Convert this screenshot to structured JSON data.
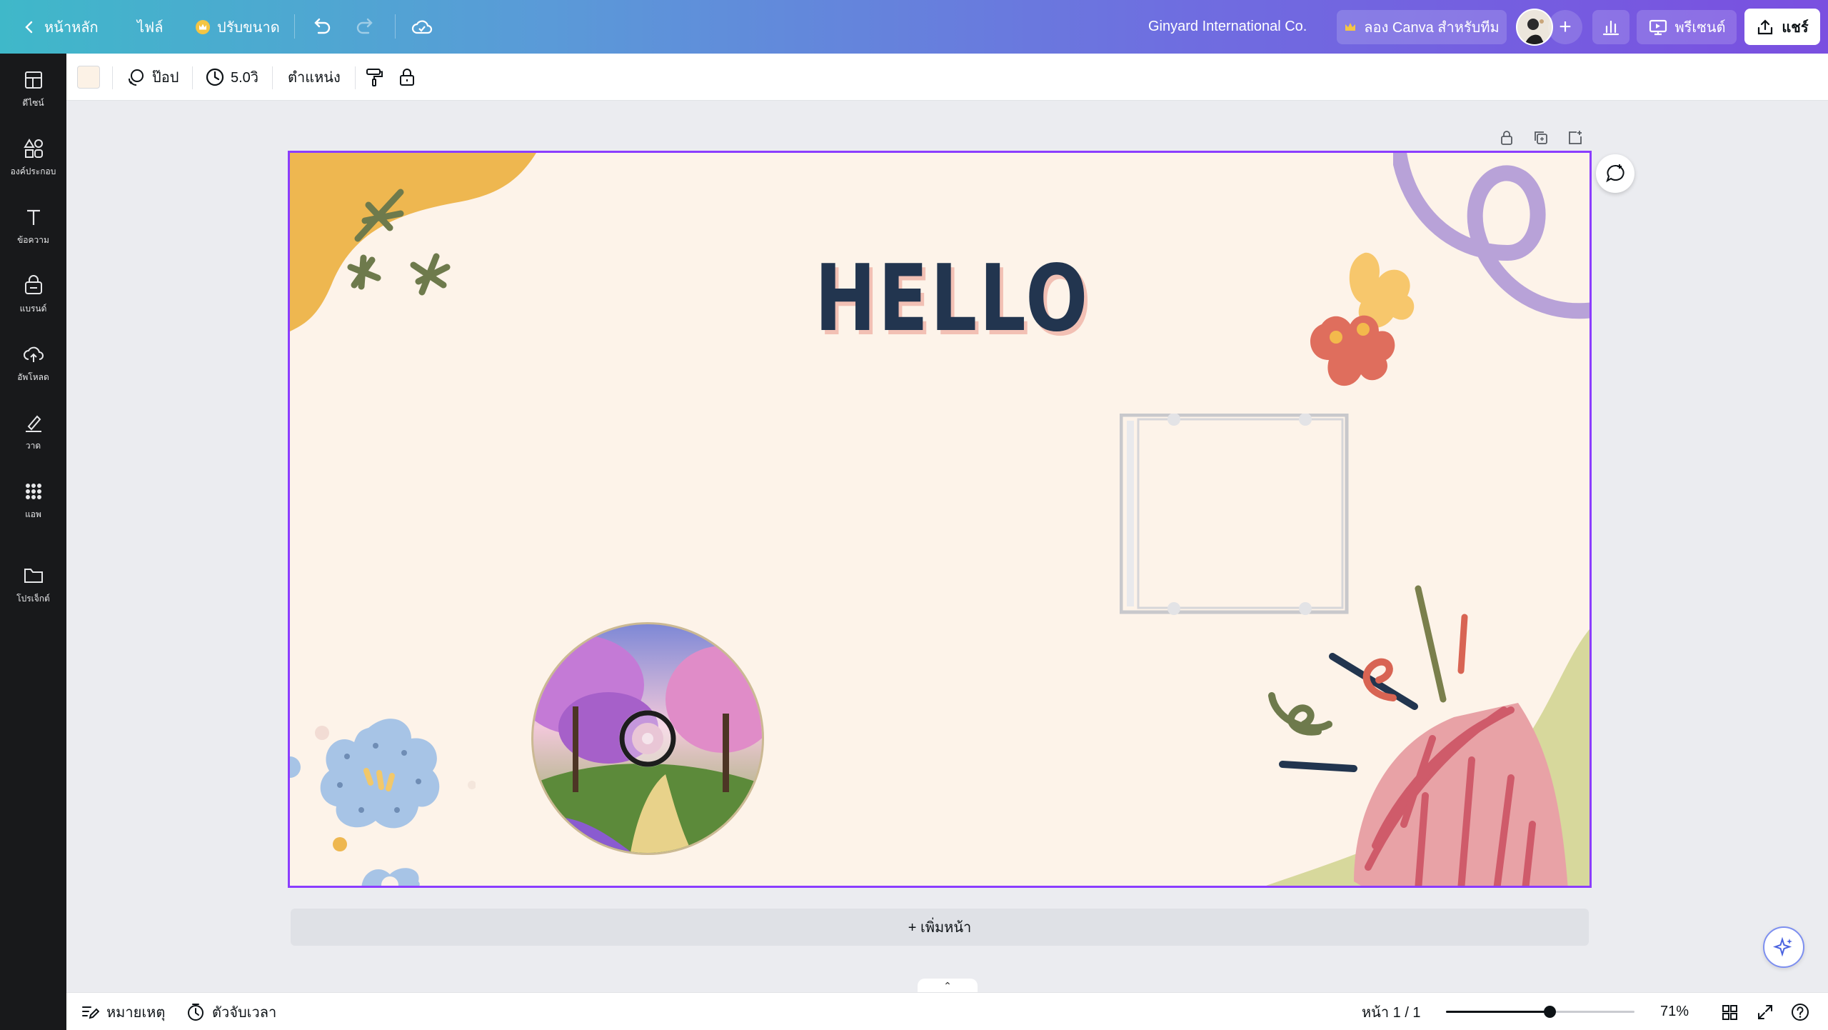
{
  "topbar": {
    "home_label": "หน้าหลัก",
    "file_label": "ไฟล์",
    "resize_label": "ปรับขนาด",
    "team_name": "Ginyard International Co.",
    "try_team_label": "ลอง Canva สำหรับทีม",
    "present_label": "พรีเซนต์",
    "share_label": "แชร์"
  },
  "sidebar": {
    "items": [
      {
        "label": "ดีไซน์",
        "icon": "layout-icon"
      },
      {
        "label": "องค์ประกอบ",
        "icon": "shapes-icon"
      },
      {
        "label": "ข้อความ",
        "icon": "text-icon"
      },
      {
        "label": "แบรนด์",
        "icon": "brand-icon"
      },
      {
        "label": "อัพโหลด",
        "icon": "upload-icon"
      },
      {
        "label": "วาด",
        "icon": "draw-icon"
      },
      {
        "label": "แอพ",
        "icon": "apps-icon"
      },
      {
        "label": "โปรเจ็กต์",
        "icon": "folder-icon"
      }
    ]
  },
  "context_toolbar": {
    "background_color": "#fcf2e6",
    "animation_label": "ป๊อป",
    "duration_label": "5.0วิ",
    "position_label": "ตำแหน่ง"
  },
  "canvas": {
    "heading": "HELLO",
    "add_page_label": "+ เพิ่มหน้า"
  },
  "bottombar": {
    "notes_label": "หมายเหตุ",
    "timer_label": "ตัวจับเวลา",
    "page_indicator": "หน้า 1 / 1",
    "zoom_level": "71%",
    "zoom_fraction": 0.55
  },
  "colors": {
    "accent": "#8b3dff",
    "canvas_bg": "#fdf3e9",
    "heading": "#22354f"
  }
}
